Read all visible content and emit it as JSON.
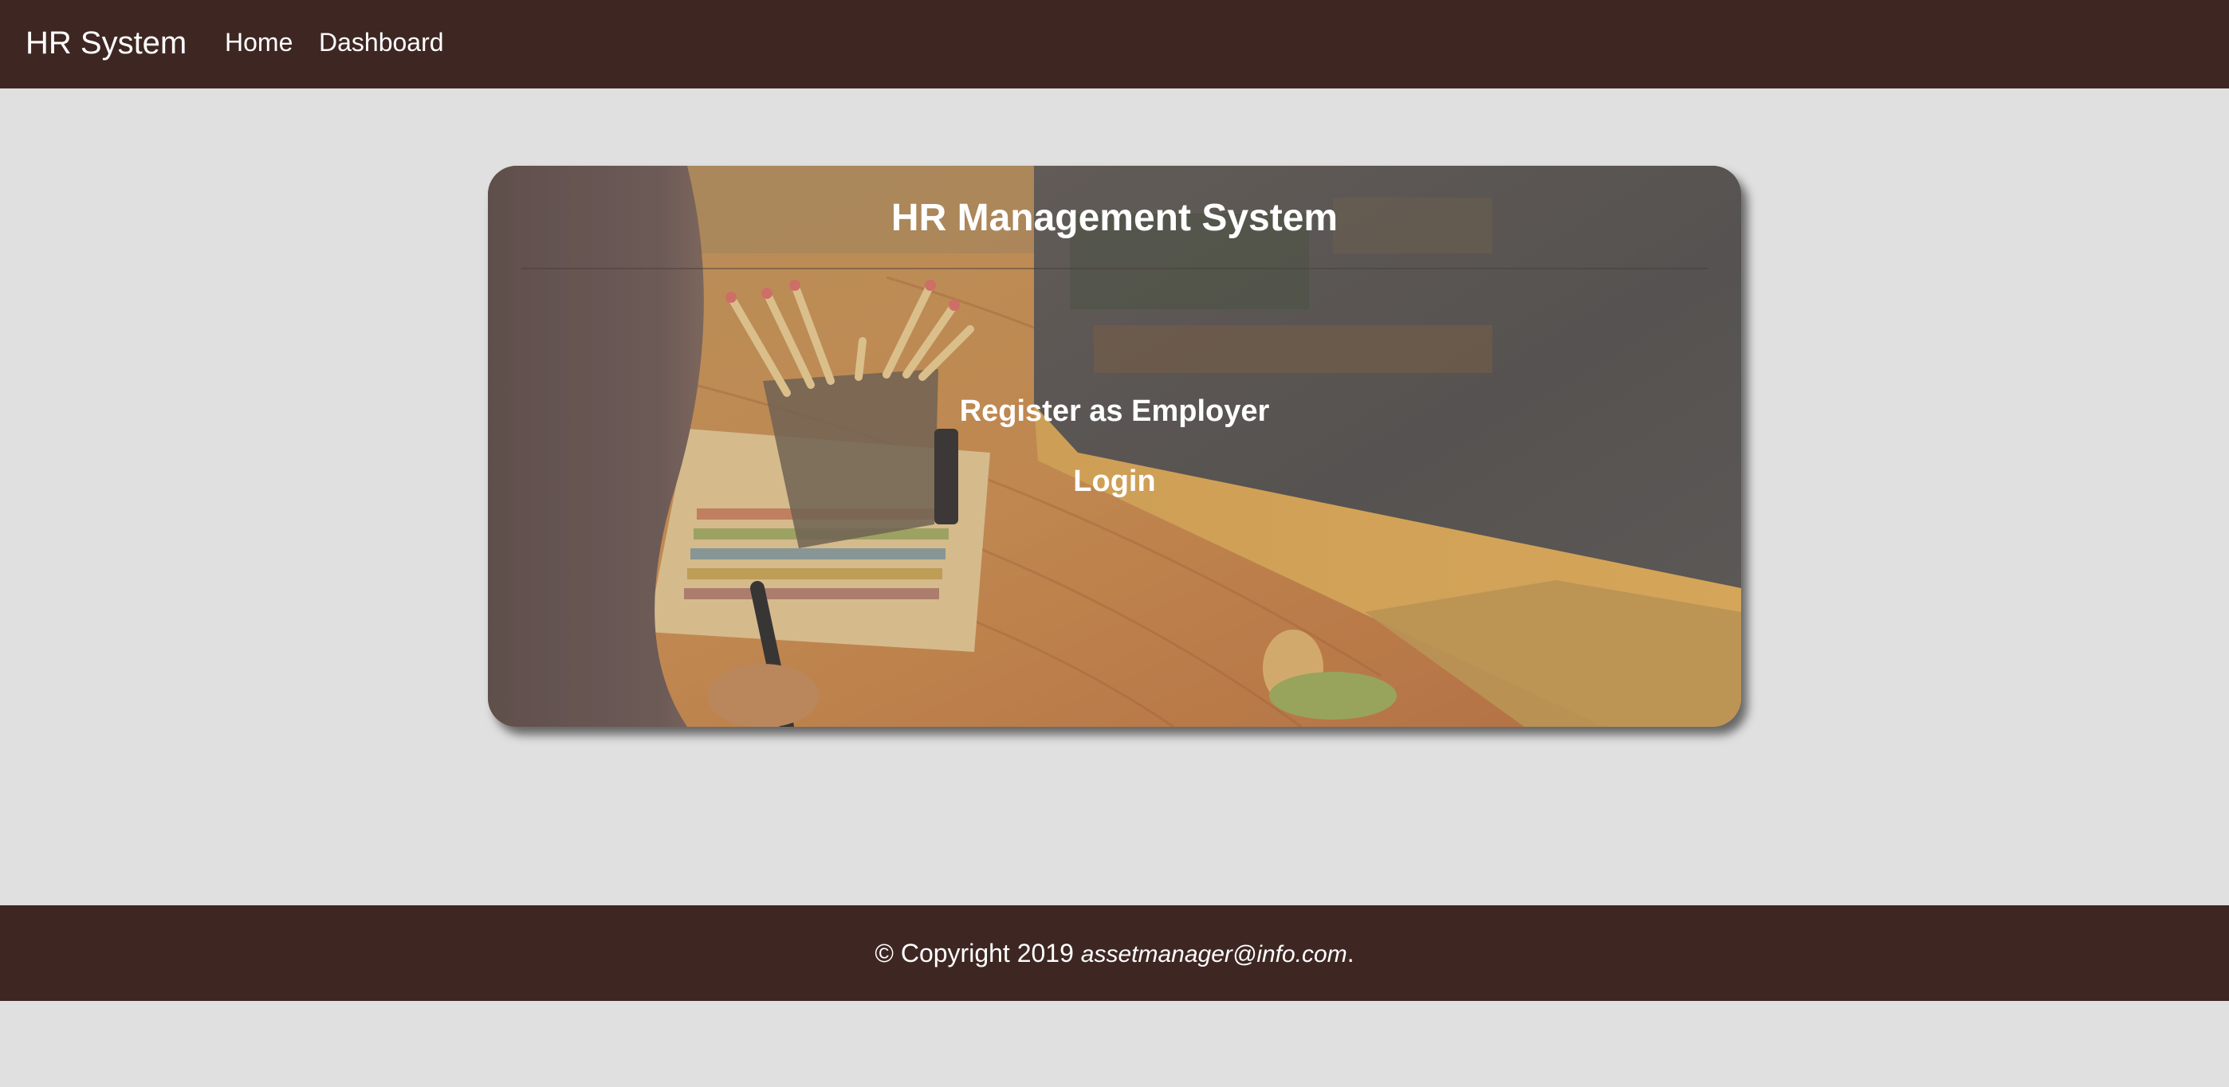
{
  "navbar": {
    "brand": "HR System",
    "links": [
      {
        "label": "Home"
      },
      {
        "label": "Dashboard"
      }
    ],
    "background": "#3e2723"
  },
  "card": {
    "title": "HR Management System",
    "actions": [
      {
        "label": "Register as Employer"
      },
      {
        "label": "Login"
      }
    ],
    "background_image": "workspace-photo"
  },
  "footer": {
    "copyright": "© Copyright 2019",
    "email": "assetmanager@info.com",
    "suffix": "."
  },
  "colors": {
    "page_background": "#e0e0e0",
    "accent": "#3e2723",
    "text": "#ffffff"
  }
}
